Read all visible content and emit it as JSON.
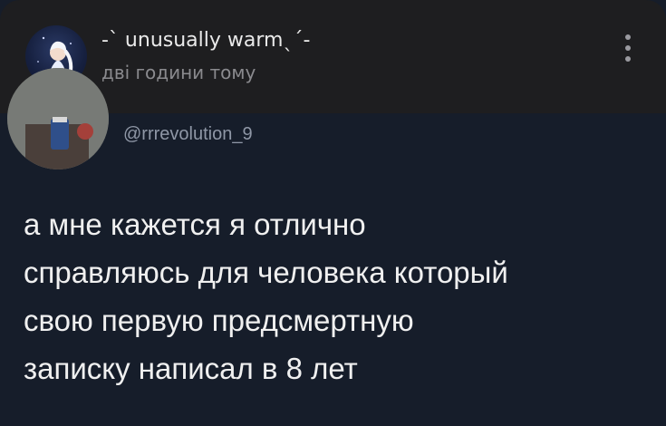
{
  "post": {
    "author": "-ˋ unusually warmˎˊ-",
    "time": "дві години тому",
    "menu_icon": "more-vertical-icon"
  },
  "tweet": {
    "handle": "@rrrevolution_9",
    "text_lines": [
      "а мне кажется я отлично",
      "справляюсь для человека который",
      "свою первую предсмертную",
      "записку написал в 8 лет"
    ]
  },
  "colors": {
    "header_bg": "#1e1e20",
    "tweet_bg": "#161d2a",
    "text": "#f0f0f0",
    "muted": "#8a8a8e"
  }
}
